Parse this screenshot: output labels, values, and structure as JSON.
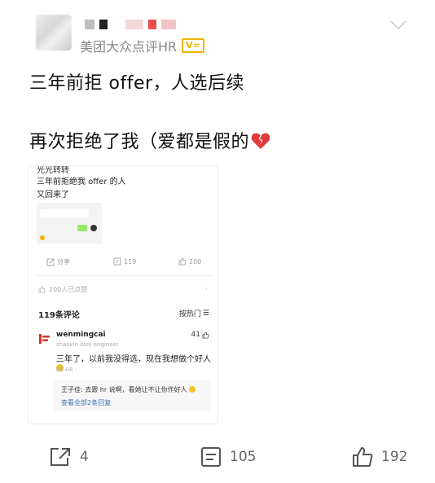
{
  "post": {
    "source": "美团大众点评HR",
    "badge": "V=",
    "line1": "三年前拒 offer，人选后续",
    "line2": "再次拒绝了我（爱都是假的"
  },
  "embed": {
    "top_text": "光光转转",
    "title1": "三年前拒绝我 offer 的人",
    "title2": "又回来了",
    "mini_share": "分享",
    "mini_comments": "119",
    "mini_likes": "200",
    "liked_text": "200人已点赞",
    "comments_header": "119条评论",
    "sort_label": "按热门",
    "comment": {
      "user": "wenmingcai",
      "subtitle": "zhaoxin bios engineer",
      "likes": "41",
      "text": "三年了，以前我没得选，现在我想做个好人",
      "date": "05-08 ·"
    },
    "reply": {
      "text": "王子佳: 去跟 hr 说啊，看她让不让你作好人",
      "more": "查看全部2条回复"
    }
  },
  "actions": {
    "share_count": "4",
    "comment_count": "105",
    "like_count": "192"
  },
  "colors": {
    "badge": "#f0b400",
    "reply_link": "#3a6fb8",
    "heart": "#e23b3b"
  }
}
